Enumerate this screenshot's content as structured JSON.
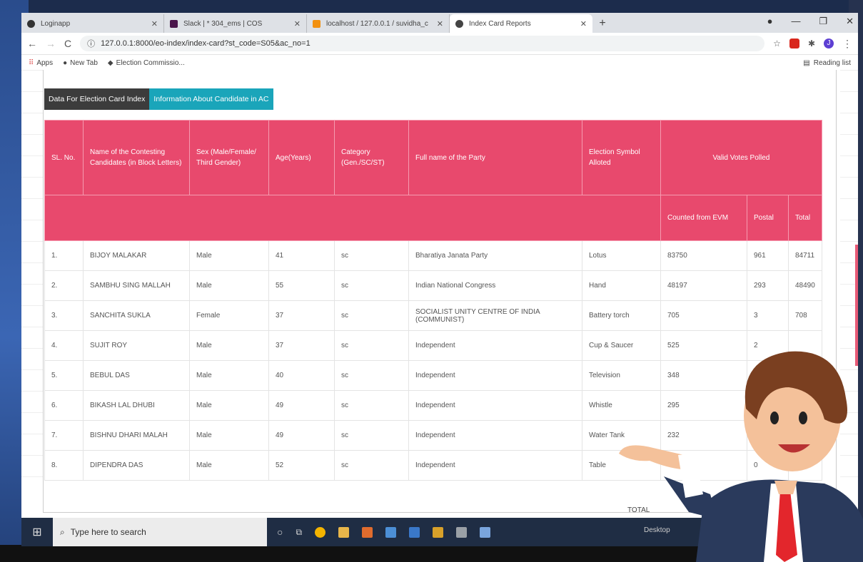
{
  "browser": {
    "tabs": [
      {
        "title": "Loginapp",
        "active": false,
        "color": "#333333"
      },
      {
        "title": "Slack | * 304_ems | COS",
        "active": false,
        "color": "#4a154b"
      },
      {
        "title": "localhost / 127.0.0.1 / suvidha_c",
        "active": false,
        "color": "#f29111"
      },
      {
        "title": "Index Card Reports",
        "active": true,
        "color": "#444444"
      }
    ],
    "url": "127.0.0.1:8000/eo-index/index-card?st_code=S05&ac_no=1",
    "bookmarks": [
      "Apps",
      "New Tab",
      "Election Commissio..."
    ],
    "reading_list": "Reading list",
    "profile_initial": "J"
  },
  "page": {
    "tabs": [
      {
        "label": "Data For Election Card Index",
        "style": "dark"
      },
      {
        "label": "Information About Candidate in AC",
        "style": "teal"
      }
    ],
    "table": {
      "headers": {
        "sl": "SL. No.",
        "name": "Name of the Contesting Candidates (in Block Letters)",
        "sex": "Sex (Male/Female/ Third Gender)",
        "age": "Age(Years)",
        "category": "Category (Gen./SC/ST)",
        "party": "Full name of the Party",
        "symbol": "Election Symbol Alloted",
        "votes": "Valid Votes Polled",
        "evm": "Counted from EVM",
        "postal": "Postal",
        "total": "Total"
      },
      "rows": [
        {
          "sl": "1.",
          "name": "BIJOY MALAKAR",
          "sex": "Male",
          "age": "41",
          "category": "sc",
          "party": "Bharatiya Janata Party",
          "symbol": "Lotus",
          "evm": "83750",
          "postal": "961",
          "total": "84711"
        },
        {
          "sl": "2.",
          "name": "SAMBHU SING MALLAH",
          "sex": "Male",
          "age": "55",
          "category": "sc",
          "party": "Indian National Congress",
          "symbol": "Hand",
          "evm": "48197",
          "postal": "293",
          "total": "48490"
        },
        {
          "sl": "3.",
          "name": "SANCHITA SUKLA",
          "sex": "Female",
          "age": "37",
          "category": "sc",
          "party": "SOCIALIST UNITY CENTRE OF INDIA (COMMUNIST)",
          "symbol": "Battery torch",
          "evm": "705",
          "postal": "3",
          "total": "708"
        },
        {
          "sl": "4.",
          "name": "SUJIT ROY",
          "sex": "Male",
          "age": "37",
          "category": "sc",
          "party": "Independent",
          "symbol": "Cup & Saucer",
          "evm": "525",
          "postal": "2",
          "total": ""
        },
        {
          "sl": "5.",
          "name": "BEBUL DAS",
          "sex": "Male",
          "age": "40",
          "category": "sc",
          "party": "Independent",
          "symbol": "Television",
          "evm": "348",
          "postal": "",
          "total": ""
        },
        {
          "sl": "6.",
          "name": "BIKASH LAL DHUBI",
          "sex": "Male",
          "age": "49",
          "category": "sc",
          "party": "Independent",
          "symbol": "Whistle",
          "evm": "295",
          "postal": "",
          "total": ""
        },
        {
          "sl": "7.",
          "name": "BISHNU DHARI MALAH",
          "sex": "Male",
          "age": "49",
          "category": "sc",
          "party": "Independent",
          "symbol": "Water Tank",
          "evm": "232",
          "postal": "",
          "total": ""
        },
        {
          "sl": "8.",
          "name": "DIPENDRA DAS",
          "sex": "Male",
          "age": "52",
          "category": "sc",
          "party": "Independent",
          "symbol": "Table",
          "evm": "",
          "postal": "0",
          "total": ""
        }
      ],
      "total_label": "TOTAL"
    }
  },
  "taskbar": {
    "search_placeholder": "Type here to search",
    "desktop_label": "Desktop"
  },
  "colors": {
    "header_pink": "#e8496d",
    "tab_teal": "#1aa5ba",
    "tab_dark": "#3c3c3c"
  }
}
